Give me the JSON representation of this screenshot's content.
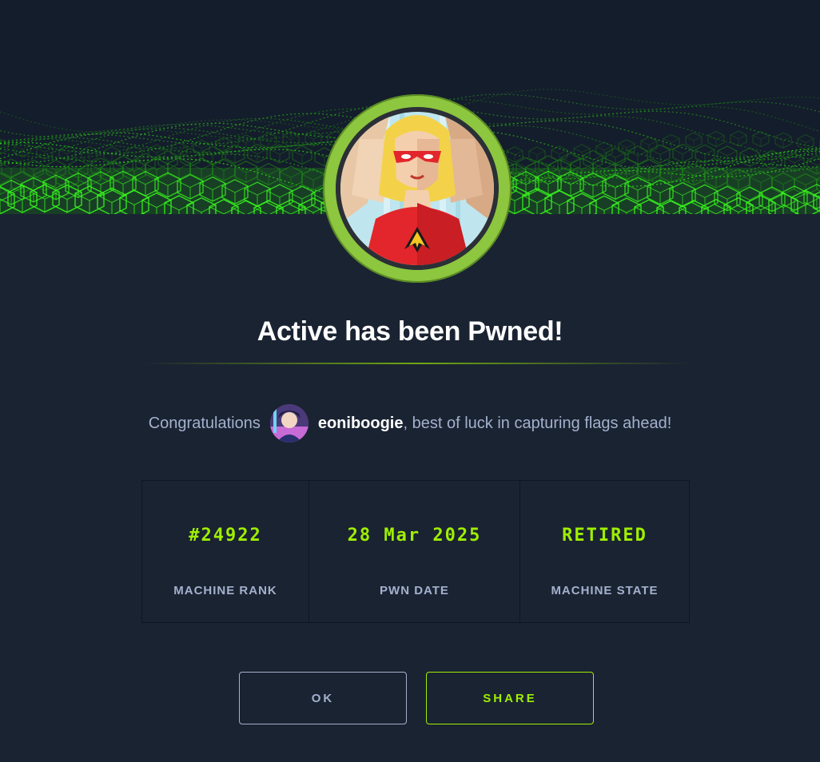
{
  "modal": {
    "title": "Active has been Pwned!",
    "congrats_prefix": "Congratulations",
    "username": "eoniboogie",
    "congrats_suffix": ", best of luck in capturing flags ahead!"
  },
  "stats": [
    {
      "value": "#24922",
      "label": "MACHINE RANK"
    },
    {
      "value": "28 Mar 2025",
      "label": "PWN DATE"
    },
    {
      "value": "RETIRED",
      "label": "MACHINE STATE"
    }
  ],
  "buttons": {
    "ok_label": "OK",
    "share_label": "SHARE"
  },
  "colors": {
    "background": "#1a2332",
    "header_background": "#141d2b",
    "accent_green": "#9fef00",
    "ring_green": "#8dc63f",
    "muted_text": "#a4b1cd"
  },
  "icons": {
    "machine_avatar": "superhero-machine-avatar",
    "user_avatar": "user-avatar",
    "banner": "green-cube-wave-banner"
  }
}
